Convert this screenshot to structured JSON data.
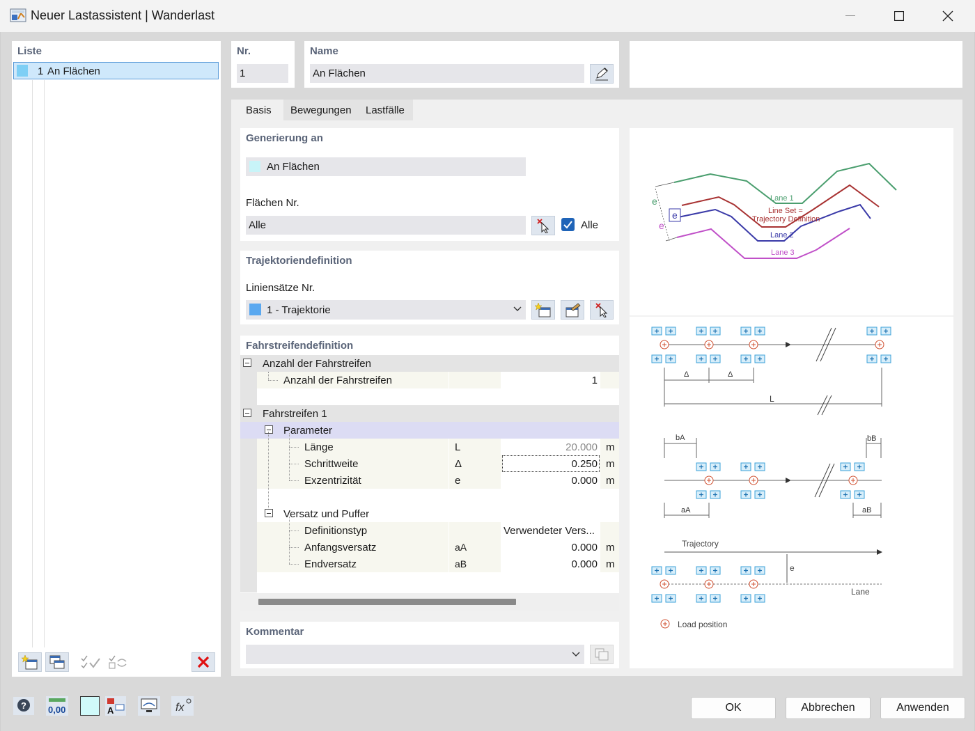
{
  "window": {
    "title": "Neuer Lastassistent | Wanderlast"
  },
  "liste": {
    "header": "Liste",
    "items": [
      {
        "nr": "1",
        "name": "An Flächen",
        "color": "#7ecff5"
      }
    ]
  },
  "nr": {
    "label": "Nr.",
    "value": "1"
  },
  "name": {
    "label": "Name",
    "value": "An Flächen"
  },
  "tabs": [
    {
      "label": "Basis",
      "active": true
    },
    {
      "label": "Bewegungen",
      "active": false
    },
    {
      "label": "Lastfälle",
      "active": false
    }
  ],
  "generierung": {
    "header": "Generierung an",
    "type_value": "An Flächen",
    "type_color": "#c8f4f8",
    "flaechen_label": "Flächen Nr.",
    "flaechen_value": "Alle",
    "alle_label": "Alle",
    "alle_checked": true
  },
  "trajektorie": {
    "header": "Trajektoriendefinition",
    "linien_label": "Liniensätze Nr.",
    "linien_value": "1 - Trajektorie",
    "linien_color": "#5aa8f0"
  },
  "fahrstreifen": {
    "header": "Fahrstreifendefinition",
    "group1": "Anzahl der Fahrstreifen",
    "anzahl_label": "Anzahl der Fahrstreifen",
    "anzahl_value": "1",
    "group2": "Fahrstreifen 1",
    "parameter": "Parameter",
    "laenge": {
      "label": "Länge",
      "sym": "L",
      "value": "20.000",
      "unit": "m"
    },
    "schritt": {
      "label": "Schrittweite",
      "sym": "Δ",
      "value": "0.250",
      "unit": "m"
    },
    "exz": {
      "label": "Exzentrizität",
      "sym": "e",
      "value": "0.000",
      "unit": "m"
    },
    "versatz": "Versatz und Puffer",
    "deftyp": {
      "label": "Definitionstyp",
      "value": "Verwendeter Vers..."
    },
    "anfang": {
      "label": "Anfangsversatz",
      "sym": "aA",
      "value": "0.000",
      "unit": "m"
    },
    "end": {
      "label": "Endversatz",
      "sym": "aB",
      "value": "0.000",
      "unit": "m"
    }
  },
  "kommentar": {
    "header": "Kommentar"
  },
  "diagram": {
    "lane1": "Lane 1",
    "lineset1": "Line Set =",
    "lineset2": "Trajectory Definition",
    "lane2": "Lane 2",
    "lane3": "Lane 3",
    "e": "e",
    "delta": "Δ",
    "L": "L",
    "bA": "bA",
    "bB": "bB",
    "aA": "aA",
    "aB": "aB",
    "trajectory": "Trajectory",
    "lane": "Lane",
    "load_position": "Load position",
    "colors": {
      "lane1": "#4a9e6e",
      "lineset": "#a83232",
      "lane2": "#3a3aa8",
      "lane3": "#c050c8",
      "load": "#d05030",
      "box": "#3aa0d8"
    }
  },
  "buttons": {
    "ok": "OK",
    "cancel": "Abbrechen",
    "apply": "Anwenden"
  },
  "footer": {
    "decimals": "0,00"
  }
}
